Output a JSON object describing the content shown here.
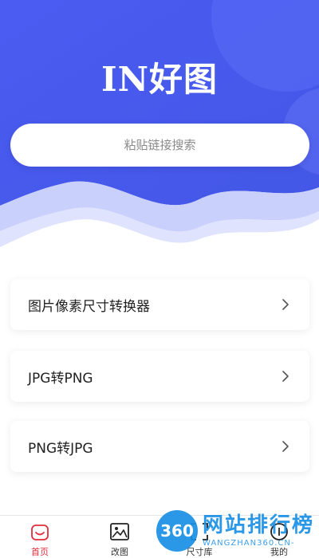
{
  "header": {
    "logo_text": "IN好图",
    "search_placeholder": "粘贴链接搜索",
    "bg_color": "#4a5ef0",
    "wave_color": "#c9d0fb"
  },
  "menu": {
    "items": [
      {
        "label": "图片像素尺寸转换器"
      },
      {
        "label": "JPG转PNG"
      },
      {
        "label": "PNG转JPG"
      }
    ]
  },
  "tabbar": {
    "tabs": [
      {
        "label": "首页",
        "icon": "home-icon",
        "active": true
      },
      {
        "label": "改图",
        "icon": "image-icon",
        "active": false
      },
      {
        "label": "尺寸库",
        "icon": "frame-icon",
        "active": false
      },
      {
        "label": "我的",
        "icon": "profile-icon",
        "active": false
      }
    ],
    "active_color": "#e02e3c"
  },
  "watermark": {
    "badge": "360",
    "title": "网站排行榜",
    "subtitle": "WANGZHAN360.CN-"
  }
}
